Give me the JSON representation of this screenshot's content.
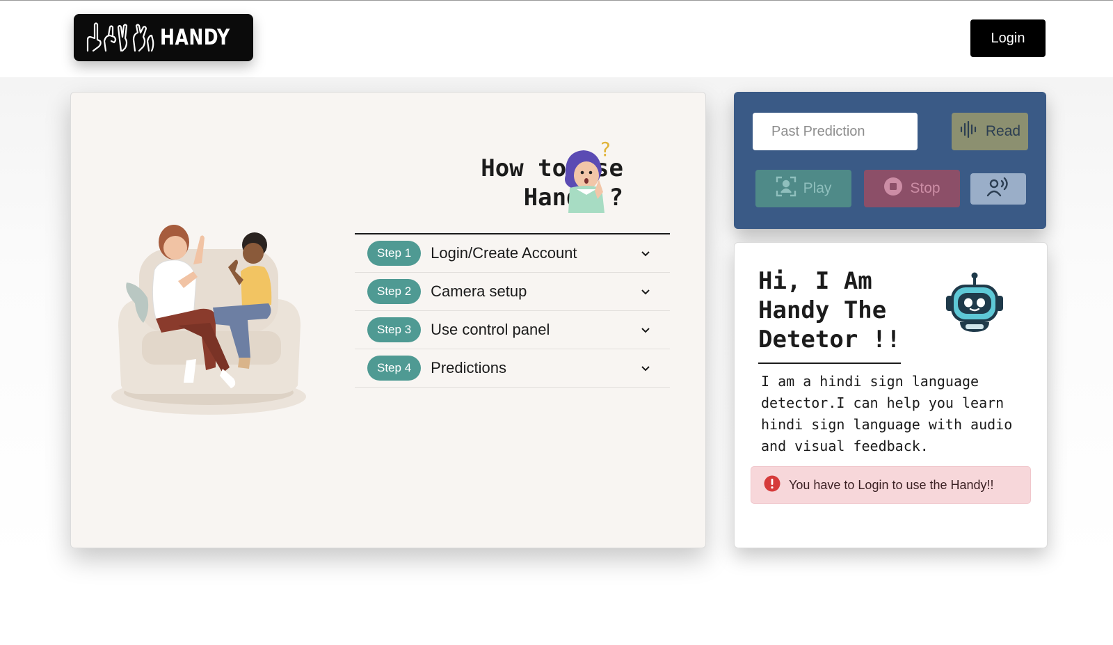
{
  "header": {
    "logo_text": "HANDY",
    "login_label": "Login"
  },
  "guide": {
    "title_line1": "How to use",
    "title_line2": "Handy ?",
    "steps": [
      {
        "pill": "Step 1",
        "label": "Login/Create Account"
      },
      {
        "pill": "Step 2",
        "label": "Camera setup"
      },
      {
        "pill": "Step 3",
        "label": "Use control panel"
      },
      {
        "pill": "Step 4",
        "label": "Predictions"
      }
    ]
  },
  "control_panel": {
    "past_prediction_placeholder": "Past Prediction",
    "read_label": "Read",
    "play_label": "Play",
    "stop_label": "Stop",
    "icons": [
      "audio-wave-icon",
      "face-scan-icon",
      "stop-circle-icon",
      "voice-recognition-icon"
    ]
  },
  "bot": {
    "title": "Hi, I Am Handy The Detetor !!",
    "description": "I am a hindi sign language detector.I can help you learn hindi sign language with audio and visual feedback.",
    "alert": "You have to Login to use the Handy!!"
  },
  "colors": {
    "step_pill": "#4f9a93",
    "control_panel_bg": "#3a5a86",
    "read_button": "#8c9070",
    "play_button": "#4f8a88",
    "stop_button": "#8c4f68",
    "voice_button": "#9aaec8",
    "alert_bg": "#f7d7da",
    "alert_icon": "#d63b3b"
  }
}
